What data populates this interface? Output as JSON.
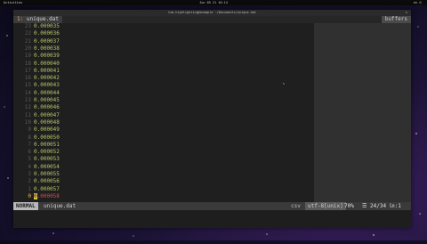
{
  "os_bar": {
    "left": "Activities",
    "center": "Jun 05 21 16:14",
    "right": "en ⏻"
  },
  "window": {
    "title": "tsb-highlighting@example ~/Documents/unique.dat",
    "close": "×"
  },
  "tabline": {
    "tab_number": "1:",
    "tab_name": "unique.dat",
    "buffers_label": "buffers"
  },
  "lines": [
    {
      "n": "23",
      "v": "0.000035"
    },
    {
      "n": "22",
      "v": "0.000036"
    },
    {
      "n": "21",
      "v": "0.000037"
    },
    {
      "n": "20",
      "v": "0.000038"
    },
    {
      "n": "19",
      "v": "0.000039"
    },
    {
      "n": "18",
      "v": "0.000040"
    },
    {
      "n": "17",
      "v": "0.000041"
    },
    {
      "n": "16",
      "v": "0.000042"
    },
    {
      "n": "15",
      "v": "0.000043"
    },
    {
      "n": "14",
      "v": "0.000044"
    },
    {
      "n": "13",
      "v": "0.000045"
    },
    {
      "n": "12",
      "v": "0.000046"
    },
    {
      "n": "11",
      "v": "0.000047"
    },
    {
      "n": "10",
      "v": "0.000048"
    },
    {
      "n": "9",
      "v": "0.000049"
    },
    {
      "n": "8",
      "v": "0.000050"
    },
    {
      "n": "7",
      "v": "0.000051"
    },
    {
      "n": "6",
      "v": "0.000052"
    },
    {
      "n": "5",
      "v": "0.000053"
    },
    {
      "n": "4",
      "v": "0.000054"
    },
    {
      "n": "3",
      "v": "0.000055"
    },
    {
      "n": "2",
      "v": "0.000056"
    },
    {
      "n": "1",
      "v": "0.000057"
    },
    {
      "n": "0",
      "v": "0.000058"
    }
  ],
  "status": {
    "mode": "NORMAL",
    "file": "unique.dat",
    "filetype": "csv",
    "encoding": "utf-8[unix]",
    "percent": "70%",
    "position": "☰ 24/34 ㏑:1"
  },
  "colors": {
    "mode_bg": "#b9b9b9",
    "number_color": "#b5c46a",
    "current_line_color": "#d84c4c",
    "cursor": "#e8c34a"
  }
}
